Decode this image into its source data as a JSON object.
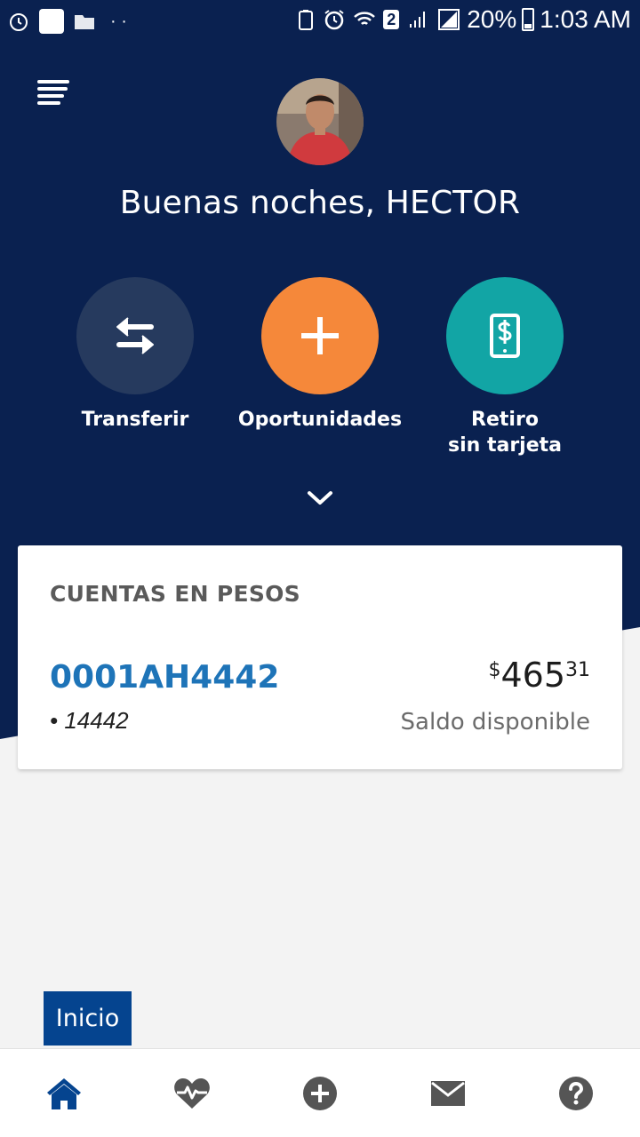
{
  "status_bar": {
    "network_badge": "2",
    "battery": "20%",
    "time": "1:03 AM"
  },
  "header": {
    "greeting": "Buenas noches, HECTOR"
  },
  "actions": [
    {
      "label_line1": "Transferir",
      "label_line2": "",
      "icon": "transfer-arrows-icon",
      "color": "#263a5e"
    },
    {
      "label_line1": "Oportunidades",
      "label_line2": "",
      "icon": "plus-icon",
      "color": "#f5883a"
    },
    {
      "label_line1": "Retiro",
      "label_line2": "sin tarjeta",
      "icon": "phone-dollar-icon",
      "color": "#12a5a5"
    }
  ],
  "accounts": {
    "title": "CUENTAS EN PESOS",
    "items": [
      {
        "id": "0001AH4442",
        "number": "• 14442",
        "currency_symbol": "$",
        "amount_int": "465",
        "amount_dec": "31",
        "balance_label": "Saldo disponible"
      }
    ]
  },
  "tooltip": {
    "label": "Inicio"
  },
  "bottom_nav": {
    "items": [
      "home-icon",
      "heartbeat-icon",
      "add-circle-icon",
      "mail-icon",
      "help-icon"
    ],
    "active_color": "#05448f",
    "inactive_color": "#555555"
  },
  "colors": {
    "header_bg": "#0a2150",
    "accent_blue": "#1e74b8",
    "orange": "#f5883a",
    "teal": "#12a5a5"
  }
}
